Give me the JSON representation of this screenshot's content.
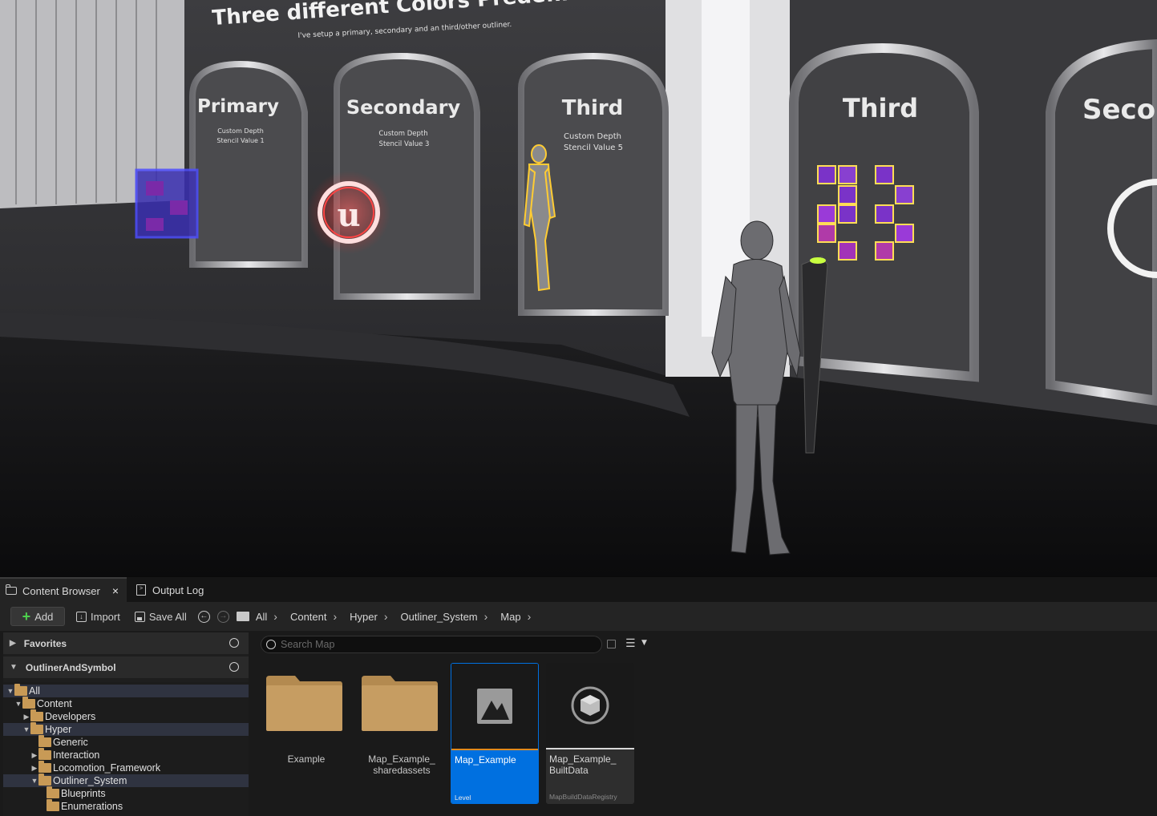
{
  "viewport": {
    "heading": "Three different Colors Predefined",
    "subheading": "I've setup a primary, secondary and an third/other outliner.",
    "panels": [
      {
        "title": "Primary",
        "line1": "Custom Depth",
        "line2": "Stencil Value 1"
      },
      {
        "title": "Secondary",
        "line1": "Custom Depth",
        "line2": "Stencil Value 3"
      },
      {
        "title": "Third",
        "line1": "Custom Depth",
        "line2": "Stencil Value 5"
      },
      {
        "title": "Third"
      },
      {
        "title": "Seco"
      }
    ]
  },
  "tabs": [
    {
      "label": "Content Browser",
      "close": "×"
    },
    {
      "label": "Output Log"
    }
  ],
  "toolbar": {
    "add_label": "Add",
    "import_label": "Import",
    "save_all_label": "Save All",
    "breadcrumb": [
      "All",
      "Content",
      "Hyper",
      "Outliner_System",
      "Map"
    ]
  },
  "sidebar": {
    "favorites_label": "Favorites",
    "collection_label": "OutlinerAndSymbol",
    "tree": [
      {
        "label": "All",
        "depth": 0,
        "expanded": true,
        "selected": true
      },
      {
        "label": "Content",
        "depth": 1,
        "expanded": true,
        "selected": false
      },
      {
        "label": "Developers",
        "depth": 2,
        "expanded": false,
        "selected": false
      },
      {
        "label": "Hyper",
        "depth": 2,
        "expanded": true,
        "selected": true
      },
      {
        "label": "Generic",
        "depth": 3,
        "expanded": null,
        "selected": false
      },
      {
        "label": "Interaction",
        "depth": 3,
        "expanded": false,
        "selected": false
      },
      {
        "label": "Locomotion_Framework",
        "depth": 3,
        "expanded": false,
        "selected": false
      },
      {
        "label": "Outliner_System",
        "depth": 3,
        "expanded": true,
        "selected": true
      },
      {
        "label": "Blueprints",
        "depth": 4,
        "expanded": null,
        "selected": false
      },
      {
        "label": "Enumerations",
        "depth": 4,
        "expanded": null,
        "selected": false
      }
    ]
  },
  "content": {
    "search_placeholder": "Search Map",
    "folders": [
      {
        "label": "Example"
      },
      {
        "label_line1": "Map_Example_",
        "label_line2": "sharedassets"
      }
    ],
    "assets": [
      {
        "name": "Map_Example",
        "type": "Level",
        "selected": true,
        "accent": "#e08a1e",
        "bg": "#0070e0"
      },
      {
        "name_line1": "Map_Example_",
        "name_line2": "BuiltData",
        "type": "MapBuildDataRegistry",
        "selected": false,
        "accent": "#d8d8d8",
        "bg": "#2e2e2e"
      }
    ]
  },
  "colors": {
    "selection_blue": "#0070e0",
    "folder_gold": "#c89a56",
    "level_accent": "#e08a1e",
    "primary_outline": "#3b3bff",
    "secondary_outline": "#ff4444",
    "third_outline": "#ffcc33"
  }
}
